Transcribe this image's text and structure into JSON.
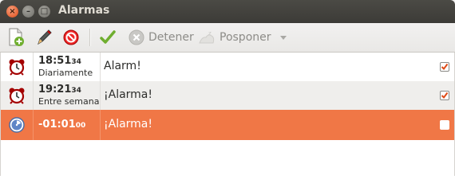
{
  "window": {
    "title": "Alarmas",
    "close_glyph": "×",
    "minimize_glyph": "–",
    "maximize_glyph": "□"
  },
  "toolbar": {
    "items": [
      {
        "name": "new-alarm",
        "icon": "new-document-icon"
      },
      {
        "name": "edit-alarm",
        "icon": "pencil-icon"
      },
      {
        "name": "delete-alarm",
        "icon": "no-entry-icon"
      },
      {
        "name": "accept",
        "icon": "checkmark-icon"
      },
      {
        "name": "stop",
        "icon": "stop-circle-icon",
        "label": "Detener"
      },
      {
        "name": "snooze",
        "icon": "snooze-icon",
        "label": "Posponer"
      }
    ]
  },
  "alarms": [
    {
      "time": "18:51",
      "seconds": "34",
      "repeat": "Diariamente",
      "message": "Alarm!",
      "enabled": true,
      "icon": "alarm-clock-icon"
    },
    {
      "time": "19:21",
      "seconds": "34",
      "repeat": "Entre semana",
      "message": "¡Alarma!",
      "enabled": true,
      "icon": "alarm-clock-icon"
    },
    {
      "time": "-01:01",
      "seconds": "00",
      "repeat": "",
      "message": "¡Alarma!",
      "enabled": false,
      "icon": "timer-icon"
    }
  ],
  "colors": {
    "selection": "#f07746",
    "titlebar": "#3c3b37",
    "close_button": "#df4a16"
  }
}
